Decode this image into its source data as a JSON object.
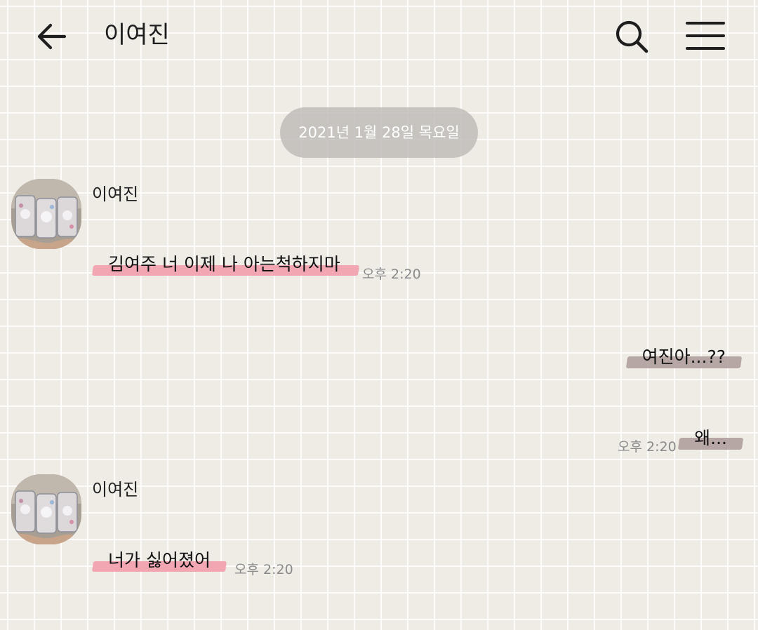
{
  "header": {
    "title": "이여진",
    "back_icon": "arrow-left-icon",
    "search_icon": "search-icon",
    "menu_icon": "hamburger-menu-icon"
  },
  "date_divider": "2021년 1월 28일 목요일",
  "messages": [
    {
      "from": "이여진",
      "side": "left",
      "text": "김여주 너 이제 나 아는척하지마",
      "time": "오후 2:20"
    },
    {
      "from": "me",
      "side": "right",
      "text": "여진아...??"
    },
    {
      "from": "me",
      "side": "right",
      "text": "왜...",
      "time": "오후 2:20"
    },
    {
      "from": "이여진",
      "side": "left",
      "text": "너가 싫어졌어",
      "time": "오후 2:20"
    }
  ],
  "colors": {
    "background": "#efebe5",
    "incoming_highlight": "#f2a0ae",
    "outgoing_highlight": "#b0a09c",
    "date_pill": "#bebab6",
    "time_text": "#8a8a8a"
  }
}
